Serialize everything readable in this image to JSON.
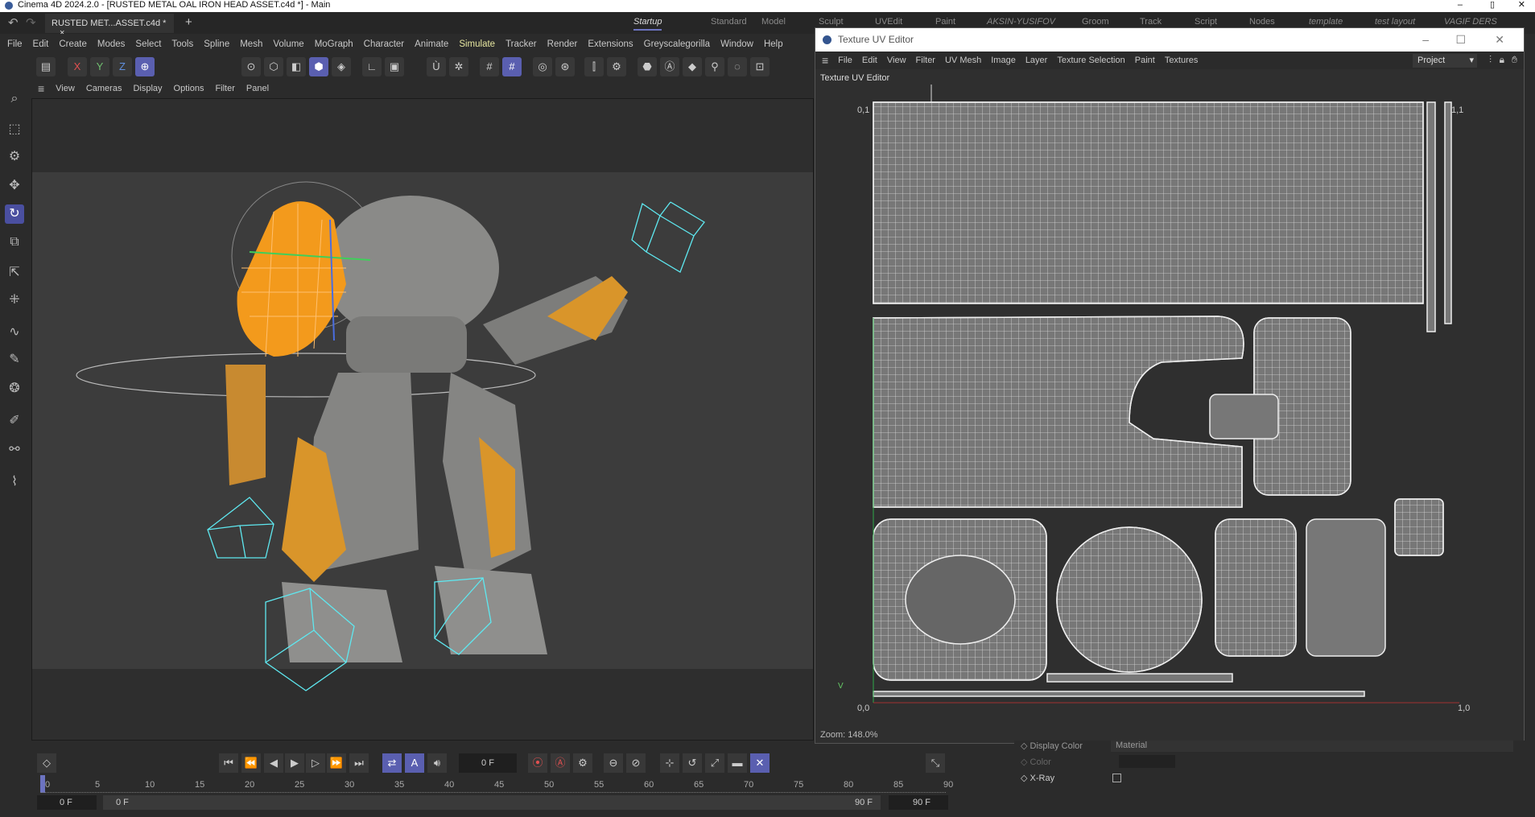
{
  "window_title": "Cinema 4D 2024.2.0 - [RUSTED METAL OAL IRON HEAD ASSET.c4d *] - Main",
  "doc_tab": {
    "label": "RUSTED MET...ASSET.c4d *",
    "close": "×",
    "add": "+"
  },
  "layouts": [
    "Startup",
    "Standard",
    "Model",
    "Sculpt",
    "UVEdit",
    "Paint",
    "AKSIN-YUSIFOV",
    "Groom",
    "Track",
    "Script",
    "Nodes",
    "template",
    "test layout",
    "VAGIF DERS"
  ],
  "menu": [
    "File",
    "Edit",
    "Create",
    "Modes",
    "Select",
    "Tools",
    "Spline",
    "Mesh",
    "Volume",
    "MoGraph",
    "Character",
    "Animate",
    "Simulate",
    "Tracker",
    "Render",
    "Extensions",
    "Greyscalegorilla",
    "Window",
    "Help"
  ],
  "axis_buttons": {
    "x": "X",
    "y": "Y",
    "z": "Z"
  },
  "viewport_menu": [
    "View",
    "Cameras",
    "Display",
    "Options",
    "Filter",
    "Panel"
  ],
  "uv_editor": {
    "title": "Texture UV Editor",
    "menu": [
      "File",
      "Edit",
      "View",
      "Filter",
      "UV Mesh",
      "Image",
      "Layer",
      "Texture Selection",
      "Paint",
      "Textures"
    ],
    "project_select": "Project",
    "panel_label": "Texture UV Editor",
    "axis": {
      "top_left": "0,1",
      "origin": "0,0",
      "right": "1,0",
      "top_right": "1,1",
      "v": "V"
    },
    "zoom": "Zoom: 148.0%"
  },
  "timeline": {
    "current_frame": "0 F",
    "ticks": [
      "0",
      "5",
      "10",
      "15",
      "20",
      "25",
      "30",
      "35",
      "40",
      "45",
      "50",
      "55",
      "60",
      "65",
      "70",
      "75",
      "80",
      "85",
      "90"
    ],
    "start": "0 F",
    "range_start": "0 F",
    "range_end": "90 F",
    "end": "90 F"
  },
  "attributes": {
    "display_color_label": "Display Color",
    "display_color_value": "Material",
    "color_label": "Color",
    "xray_label": "X-Ray"
  },
  "colors": {
    "accent": "#5a5fb0",
    "selection": "#f39a1c",
    "cage": "#5ee8f0"
  }
}
